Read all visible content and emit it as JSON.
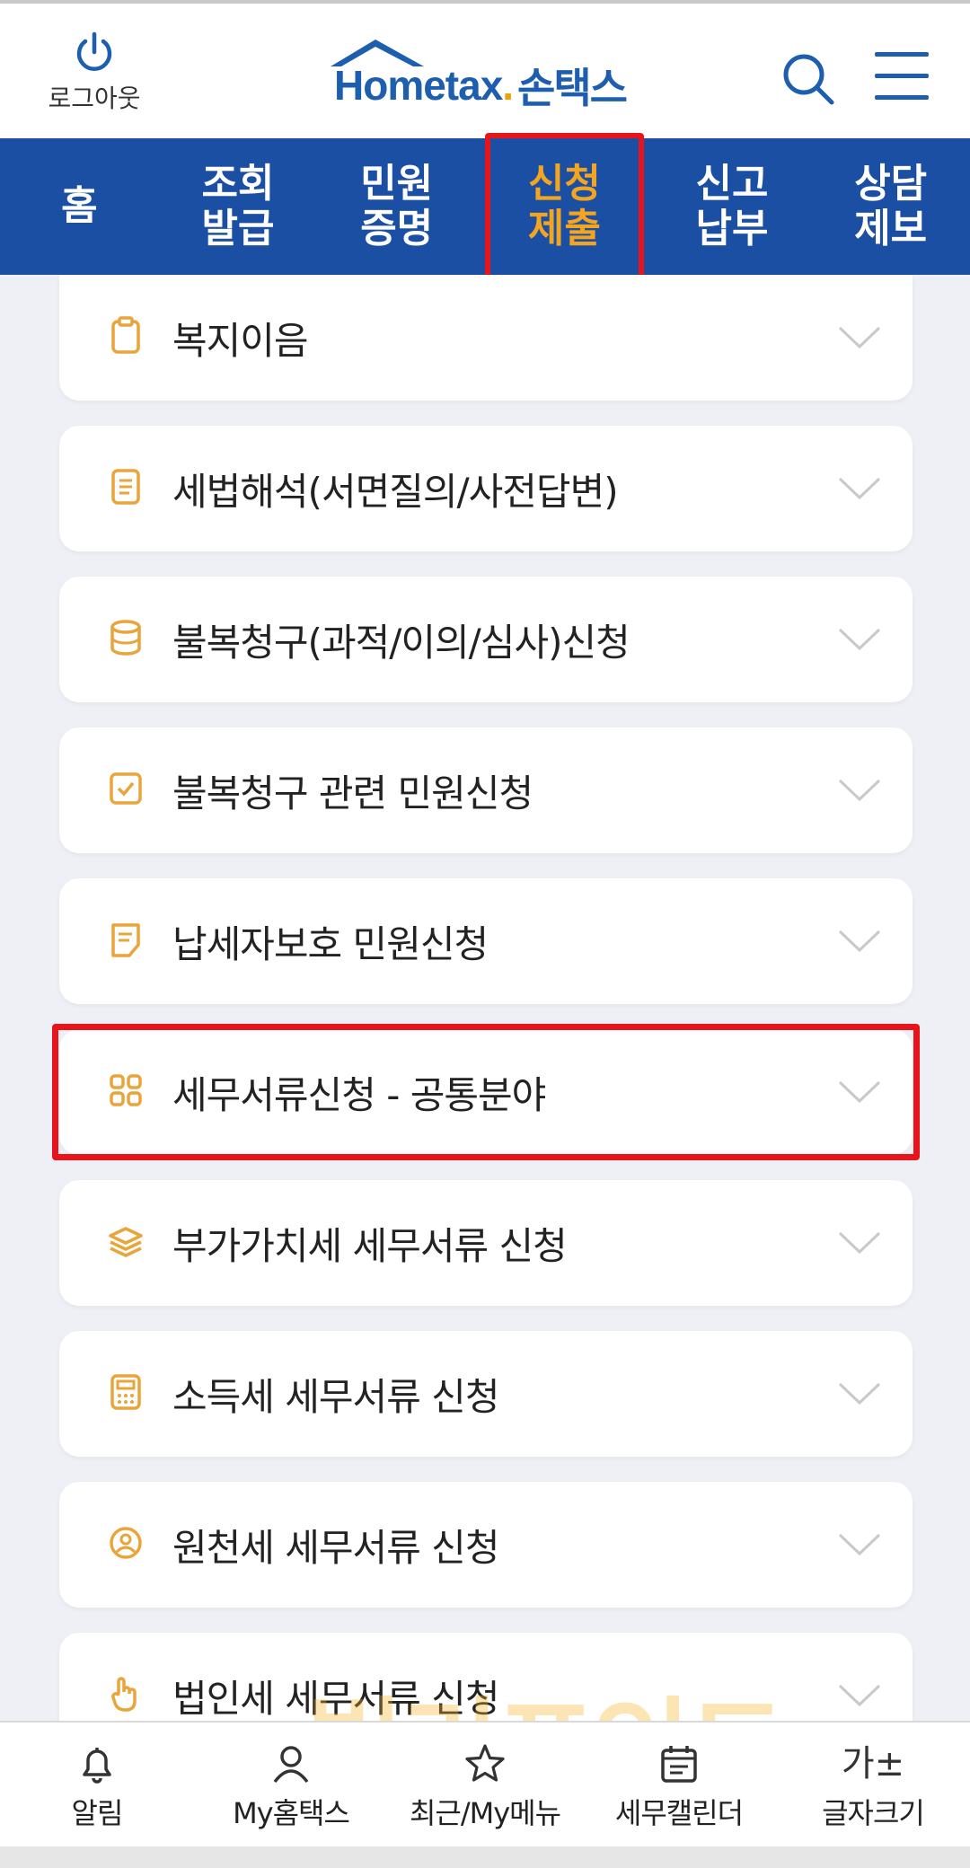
{
  "header": {
    "logout_label": "로그아웃",
    "logo_text": "Hometax",
    "logo_dot": ".",
    "logo_sub": "손택스"
  },
  "nav": {
    "items": [
      {
        "line1": "홈",
        "line2": ""
      },
      {
        "line1": "조회",
        "line2": "발급"
      },
      {
        "line1": "민원",
        "line2": "증명"
      },
      {
        "line1": "신청",
        "line2": "제출"
      },
      {
        "line1": "신고",
        "line2": "납부"
      },
      {
        "line1": "상담",
        "line2": "제보"
      }
    ],
    "active_index": 3,
    "bg_color": "#1a4fa3",
    "active_color": "#f3a51f"
  },
  "menu": {
    "items": [
      {
        "label": "복지이음",
        "icon": "clipboard-icon"
      },
      {
        "label": "세법해석(서면질의/사전답변)",
        "icon": "document-icon"
      },
      {
        "label": "불복청구(과적/이의/심사)신청",
        "icon": "database-icon"
      },
      {
        "label": "불복청구 관련 민원신청",
        "icon": "checkbox-icon"
      },
      {
        "label": "납세자보호 민원신청",
        "icon": "note-icon"
      },
      {
        "label": "세무서류신청 - 공통분야",
        "icon": "grid-icon"
      },
      {
        "label": "부가가치세 세무서류 신청",
        "icon": "layers-icon"
      },
      {
        "label": "소득세 세무서류 신청",
        "icon": "calculator-icon"
      },
      {
        "label": "원천세 세무서류 신청",
        "icon": "user-circle-icon"
      },
      {
        "label": "법인세 세무서류 신청",
        "icon": "hand-icon"
      }
    ],
    "highlighted_index": 5,
    "icon_color": "#e9a43a"
  },
  "watermark": "빌리포인트",
  "bottom_nav": {
    "items": [
      {
        "label": "알림",
        "icon": "bell-icon"
      },
      {
        "label": "My홈택스",
        "icon": "person-icon"
      },
      {
        "label": "최근/My메뉴",
        "icon": "star-icon"
      },
      {
        "label": "세무캘린더",
        "icon": "calendar-icon"
      },
      {
        "label": "글자크기",
        "icon": "font-size-icon",
        "glyph": "가±"
      }
    ]
  }
}
